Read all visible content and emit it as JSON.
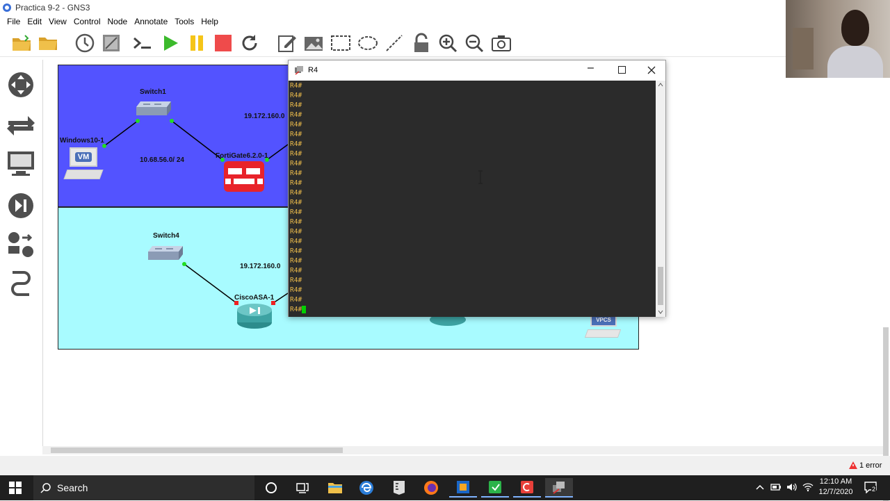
{
  "window": {
    "title": "Practica 9-2 - GNS3"
  },
  "menu": [
    "File",
    "Edit",
    "View",
    "Control",
    "Node",
    "Annotate",
    "Tools",
    "Help"
  ],
  "toolbar": {
    "icons": [
      "open-project-icon",
      "folder-icon",
      "clock-icon",
      "snapshot-icon",
      "console-all-icon",
      "start-all-icon",
      "suspend-all-icon",
      "stop-all-icon",
      "reload-all-icon",
      "add-note-icon",
      "insert-image-icon",
      "draw-rectangle-icon",
      "draw-ellipse-icon",
      "draw-line-icon",
      "lock-icon",
      "zoom-in-icon",
      "zoom-out-icon",
      "screenshot-icon"
    ]
  },
  "topology": {
    "nodes": {
      "switch1": "Switch1",
      "windows": "Windows10-1",
      "fortigate": "FortiGate6.2.0-1",
      "switch4": "Switch4",
      "ciscoasa": "CiscoASA-1",
      "vpcs": "VPCS",
      "vm_badge": "VM"
    },
    "labels": {
      "net_top_left": "10.68.56.0/ 24",
      "net_top_right": "19.172.160.0",
      "net_bottom": "19.172.160.0"
    }
  },
  "terminal": {
    "title": "R4",
    "prompt": "R4#",
    "line_count": 24,
    "cursor_color": "#00d000"
  },
  "status": {
    "error_text": "1 error"
  },
  "taskbar": {
    "search_label": "Search",
    "time": "12:10 AM",
    "date": "12/7/2020",
    "notifications": "2"
  },
  "colors": {
    "zone_top": "#5353ff",
    "zone_bottom": "#a8fbff",
    "terminal_bg": "#2b2b2b",
    "prompt": "#e8b84a",
    "link_up": "#22dd22",
    "link_down": "#ee2222"
  }
}
